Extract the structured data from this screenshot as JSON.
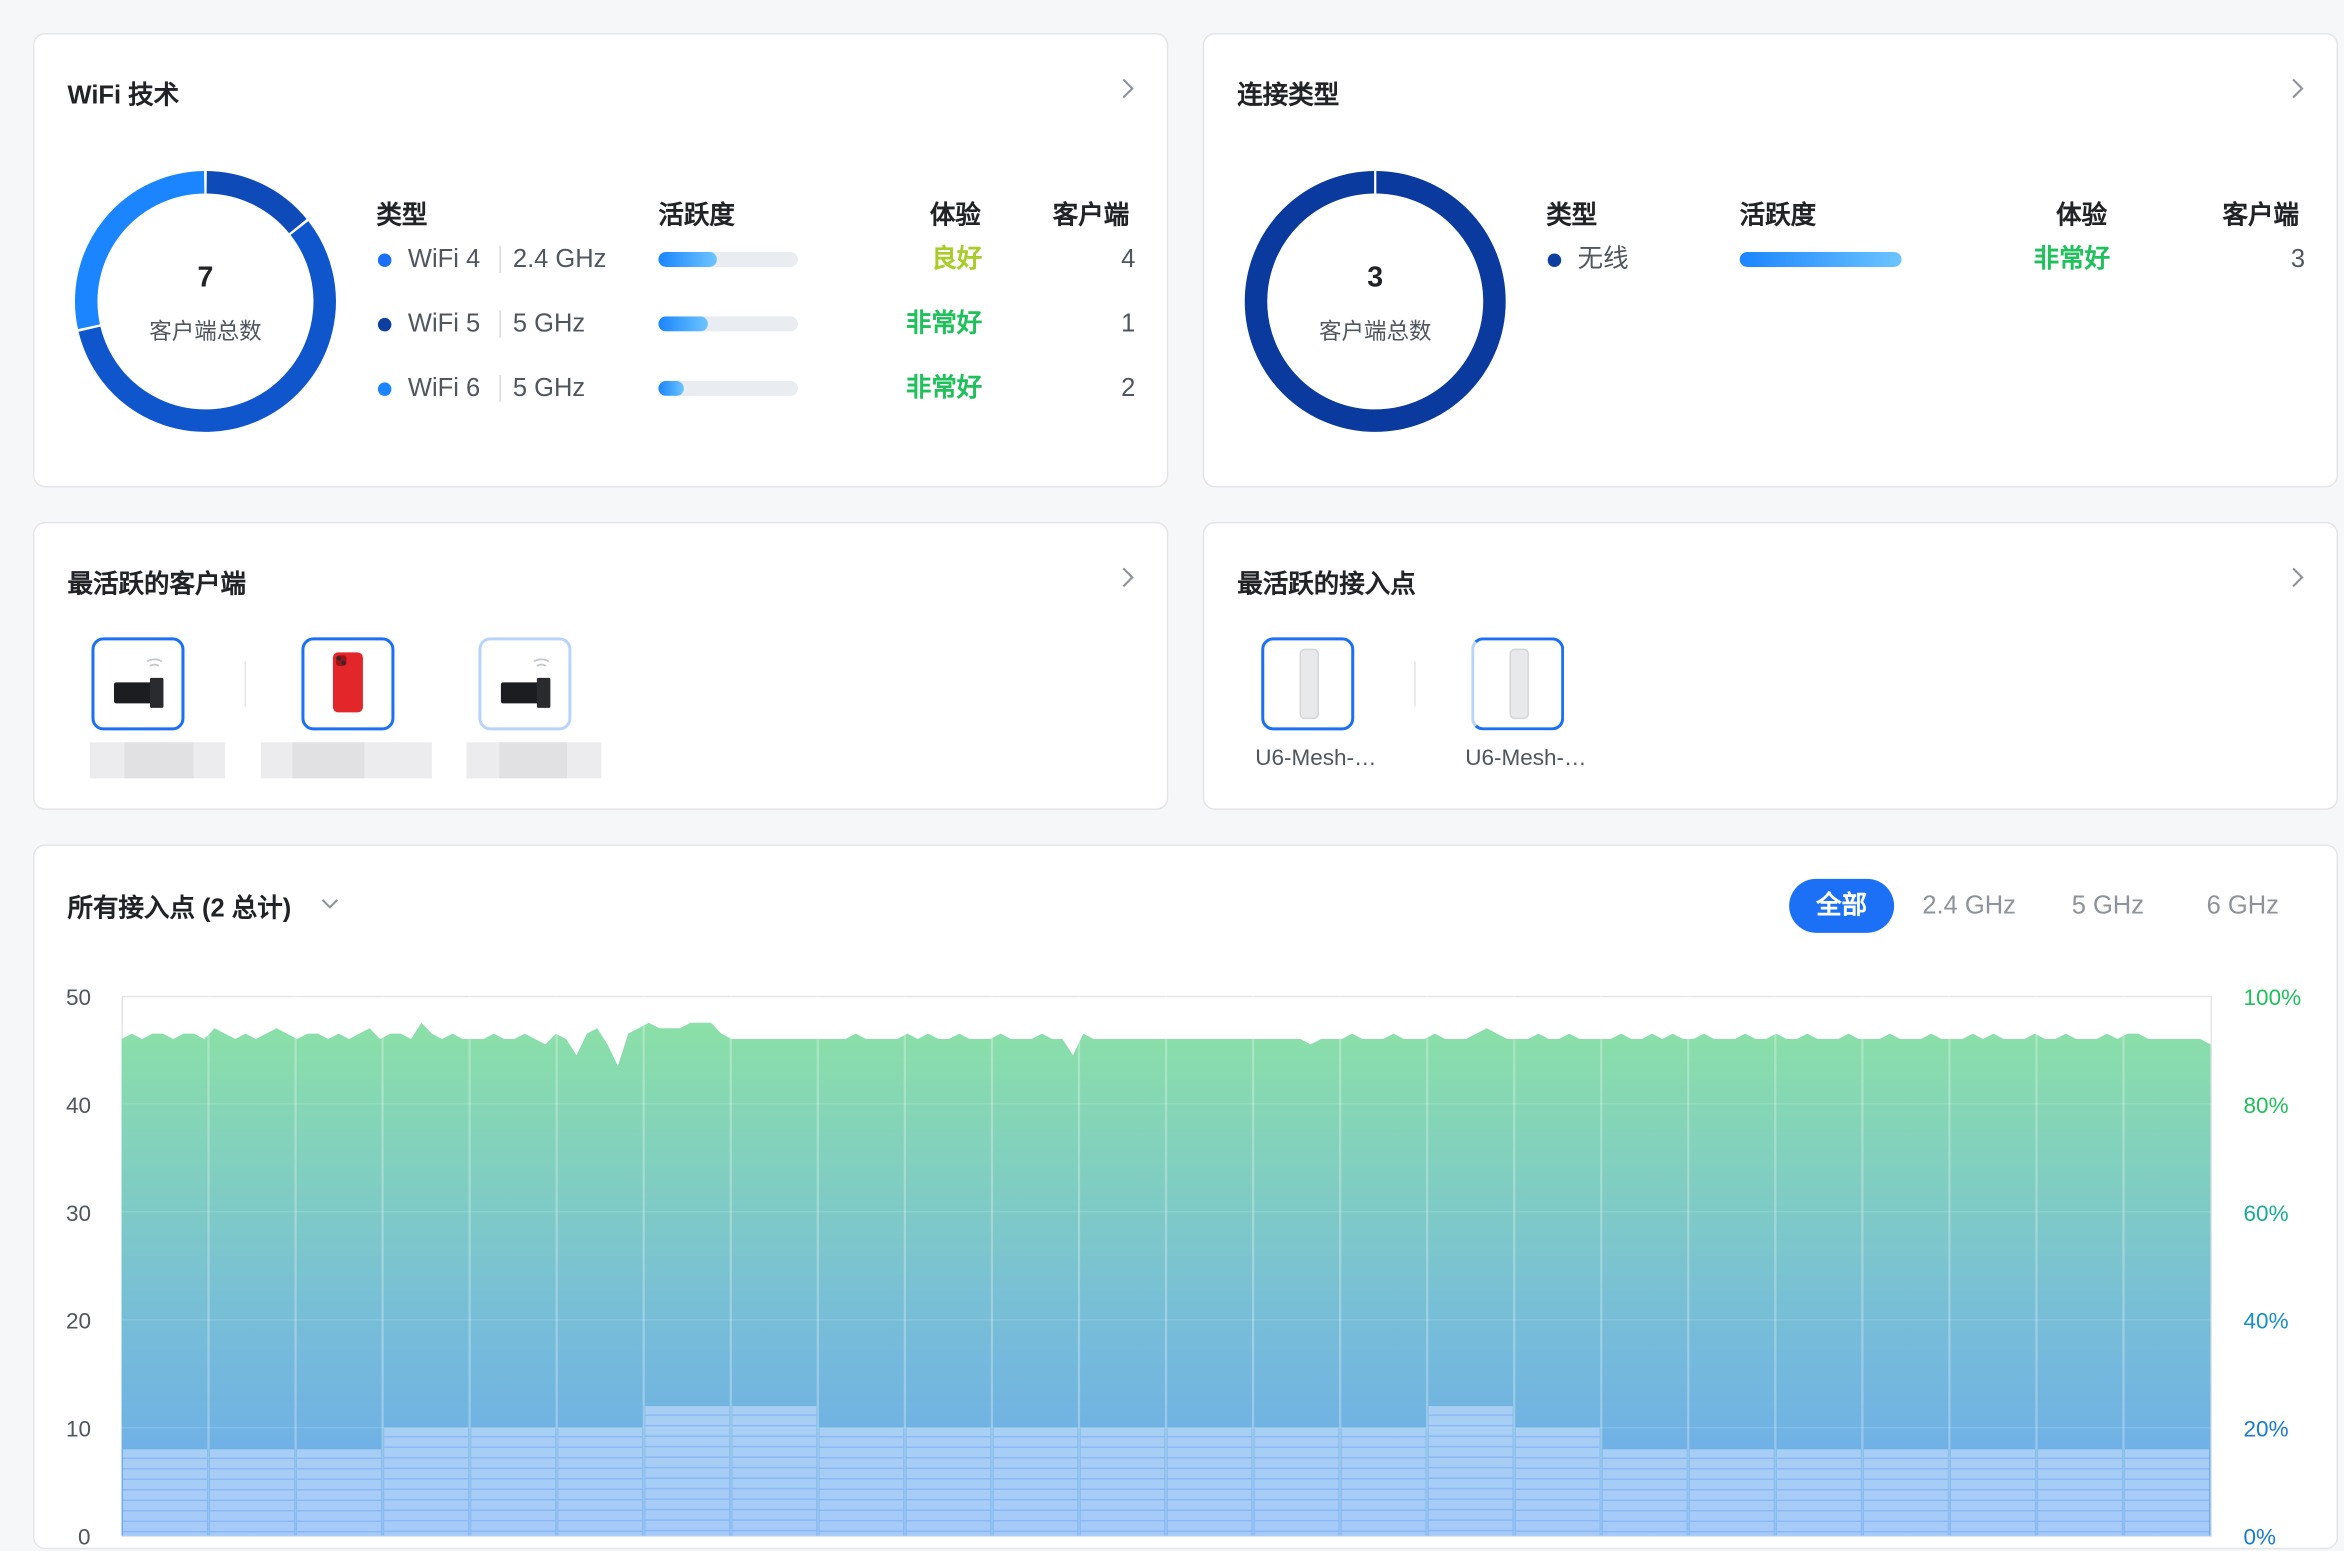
{
  "wifi_tech": {
    "title": "WiFi 技术",
    "total": "7",
    "total_label": "客户端总数",
    "headers": {
      "type": "类型",
      "activity": "活跃度",
      "experience": "体验",
      "clients": "客户端"
    },
    "rows": [
      {
        "name": "WiFi 4",
        "band": "2.4 GHz",
        "activity_fraction": 0.42,
        "experience": "良好",
        "clients": "4",
        "dot_color": "#1b70f5",
        "exp_color": "#a8cd2a"
      },
      {
        "name": "WiFi 5",
        "band": "5 GHz",
        "activity_fraction": 0.35,
        "experience": "非常好",
        "clients": "1",
        "dot_color": "#0f3f9e",
        "exp_color": "#20c05c"
      },
      {
        "name": "WiFi 6",
        "band": "5 GHz",
        "activity_fraction": 0.18,
        "experience": "非常好",
        "clients": "2",
        "dot_color": "#1b85ff",
        "exp_color": "#20c05c"
      }
    ],
    "donut": [
      {
        "value": 1,
        "color": "#0f4bb8"
      },
      {
        "value": 4,
        "color": "#0f55cc"
      },
      {
        "value": 2,
        "color": "#1b85ff"
      }
    ]
  },
  "conn_type": {
    "title": "连接类型",
    "total": "3",
    "total_label": "客户端总数",
    "headers": {
      "type": "类型",
      "activity": "活跃度",
      "experience": "体验",
      "clients": "客户端"
    },
    "rows": [
      {
        "name": "无线",
        "activity_fraction": 1.0,
        "experience": "非常好",
        "clients": "3",
        "dot_color": "#0f3f9e",
        "exp_color": "#20c05c"
      }
    ],
    "donut_color": "#0a3a9e"
  },
  "top_clients": {
    "title": "最活跃的客户端",
    "devices": [
      {
        "icon": "usb-wifi-adapter-icon"
      },
      {
        "icon": "red-phone-icon"
      },
      {
        "icon": "usb-wifi-adapter-icon"
      }
    ]
  },
  "top_aps": {
    "title": "最活跃的接入点",
    "aps": [
      {
        "label": "U6-Mesh-…",
        "icon": "access-point-icon"
      },
      {
        "label": "U6-Mesh-…",
        "icon": "access-point-icon"
      }
    ]
  },
  "all_aps": {
    "title": "所有接入点 (2 总计)",
    "bands": [
      "全部",
      "2.4 GHz",
      "5 GHz",
      "6 GHz"
    ],
    "active_band": "全部"
  },
  "chart_data": {
    "type": "area",
    "title": "",
    "xlabel": "",
    "ylabel": "",
    "ylim": [
      0,
      50
    ],
    "y2lim": [
      0,
      100
    ],
    "yticks": [
      "50",
      "40",
      "30",
      "20",
      "10",
      "0"
    ],
    "y2ticks": [
      "100%",
      "80%",
      "60%",
      "40%",
      "20%",
      "0%"
    ],
    "grid": true,
    "series": [
      {
        "values": [
          92,
          93,
          92,
          93,
          93,
          92,
          93,
          93,
          92,
          94,
          93,
          92,
          93,
          92,
          93,
          94,
          93,
          92,
          93,
          93,
          92,
          93,
          92,
          93,
          94,
          92,
          93,
          93,
          92,
          95,
          93,
          92,
          93,
          92,
          92,
          92,
          93,
          92,
          92,
          93,
          92,
          91,
          93,
          92,
          89,
          93,
          94,
          91,
          87,
          93,
          94,
          95,
          94,
          94,
          94,
          95,
          95,
          95,
          93,
          92,
          92,
          92,
          92,
          92,
          92,
          92,
          92,
          92,
          92,
          92,
          92,
          93,
          92,
          92,
          92,
          92,
          93,
          92,
          93,
          92,
          92,
          93,
          92,
          92,
          92,
          93,
          92,
          92,
          92,
          93,
          92,
          92,
          89,
          93,
          92,
          92,
          92,
          92,
          92,
          92,
          92,
          92,
          92,
          92,
          92,
          92,
          92,
          92,
          92,
          92,
          92,
          92,
          92,
          92,
          92,
          91,
          92,
          92,
          92,
          93,
          92,
          92,
          92,
          93,
          92,
          92,
          92,
          93,
          92,
          92,
          92,
          93,
          94,
          93,
          92,
          92,
          92,
          93,
          92,
          92,
          93,
          92,
          92,
          92,
          92,
          93,
          92,
          92,
          93,
          92,
          93,
          92,
          92,
          93,
          92,
          92,
          92,
          93,
          92,
          92,
          93,
          92,
          92,
          93,
          92,
          92,
          92,
          93,
          92,
          92,
          92,
          93,
          92,
          92,
          92,
          93,
          92,
          92,
          92,
          93,
          92,
          93,
          92,
          92,
          92,
          93,
          92,
          92,
          93,
          92,
          92,
          92,
          93,
          92,
          93,
          93,
          92,
          92,
          92,
          92,
          92,
          92,
          91
        ]
      },
      {
        "values": [
          8,
          8,
          8,
          10,
          10,
          10,
          12,
          12,
          10,
          10,
          10,
          10,
          10,
          10,
          10,
          12,
          10,
          8,
          8,
          8,
          8,
          8,
          8,
          8
        ]
      }
    ]
  }
}
